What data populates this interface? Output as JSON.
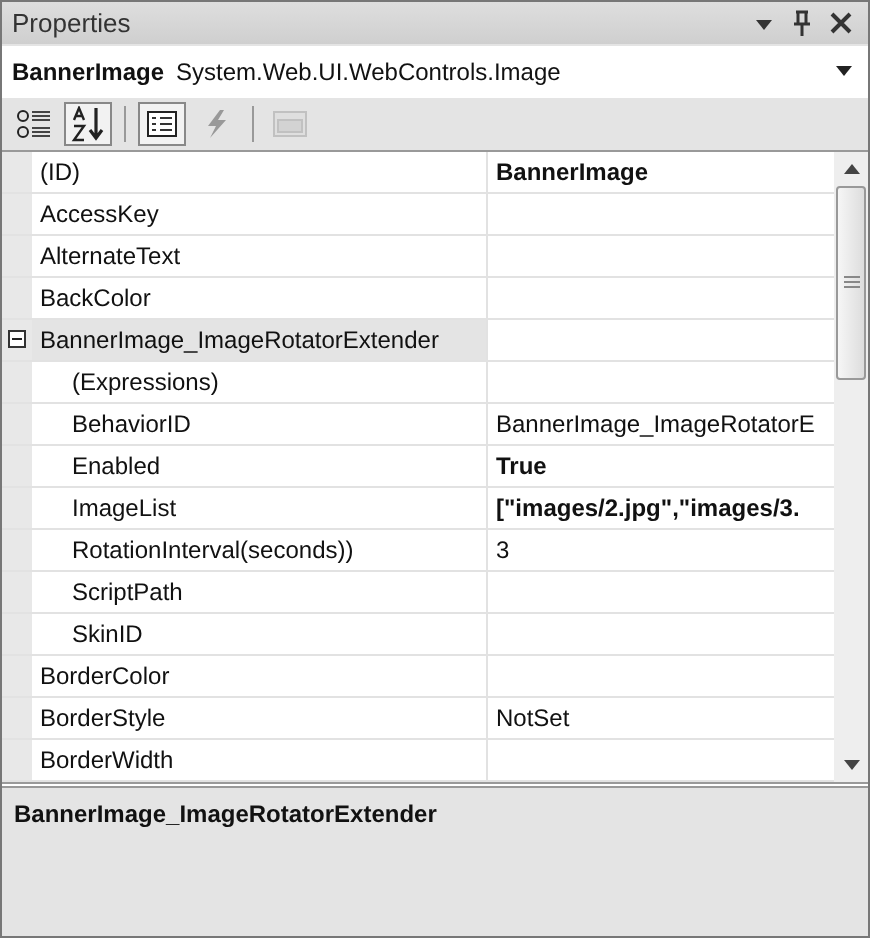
{
  "window": {
    "title": "Properties"
  },
  "object_selector": {
    "name": "BannerImage",
    "type": "System.Web.UI.WebControls.Image"
  },
  "toolbar": [
    {
      "kind": "categorized",
      "selected": false,
      "disabled": false
    },
    {
      "kind": "alphabetical",
      "selected": true,
      "disabled": false
    },
    {
      "kind": "properties",
      "selected": true,
      "disabled": false
    },
    {
      "kind": "events",
      "selected": false,
      "disabled": false
    },
    {
      "kind": "property-pages",
      "selected": false,
      "disabled": true
    }
  ],
  "rows": [
    {
      "name": "(ID)",
      "value": "BannerImage",
      "changed": true,
      "selected": false
    },
    {
      "name": "AccessKey",
      "selected": false
    },
    {
      "name": "AlternateText",
      "selected": false
    },
    {
      "name": "BackColor",
      "selected": false
    },
    {
      "name": "BannerImage_ImageRotatorExtender",
      "selected": true,
      "expanded": true,
      "children": [
        {
          "name": "(Expressions)",
          "selected": false
        },
        {
          "name": "BehaviorID",
          "value": "BannerImage_ImageRotatorE",
          "changed": false,
          "selected": false
        },
        {
          "name": "Enabled",
          "value": "True",
          "changed": true,
          "selected": false
        },
        {
          "name": "ImageList",
          "value": "[\"images/2.jpg\",\"images/3.",
          "changed": true,
          "selected": false
        },
        {
          "name": "RotationInterval(seconds))",
          "value": "3",
          "changed": false,
          "selected": false
        },
        {
          "name": "ScriptPath",
          "selected": false
        },
        {
          "name": "SkinID",
          "selected": false
        }
      ]
    },
    {
      "name": "BorderColor",
      "selected": false
    },
    {
      "name": "BorderStyle",
      "value": "NotSet",
      "changed": false,
      "selected": false
    },
    {
      "name": "BorderWidth",
      "selected": false
    }
  ],
  "description": {
    "title": "BannerImage_ImageRotatorExtender"
  }
}
